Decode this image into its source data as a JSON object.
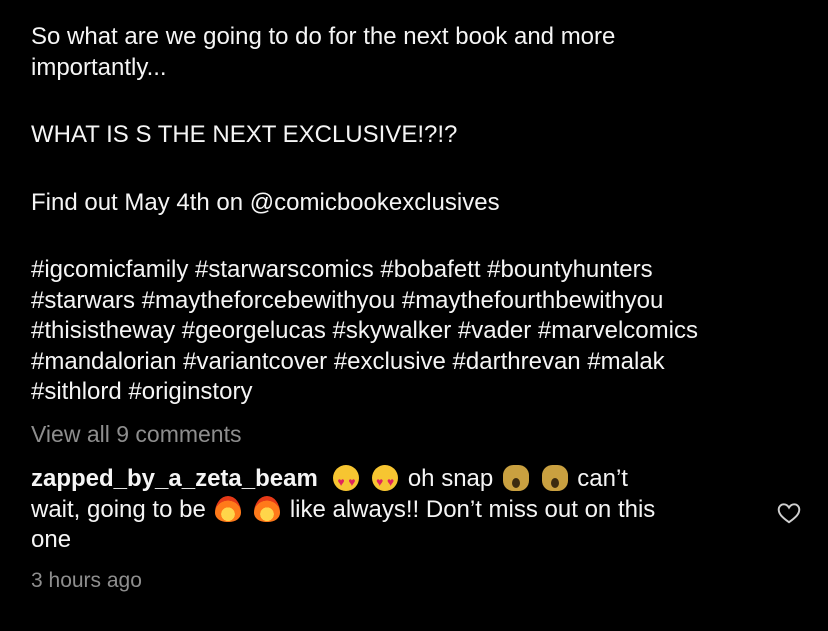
{
  "post": {
    "caption_lines": [
      "So what are we going to do for the next book and more",
      "importantly...",
      "WHAT IS S THE NEXT EXCLUSIVE!?!?",
      "Find out May 4th on @comicbookexclusives",
      "#igcomicfamily #starwarscomics #bobafett #bountyhunters",
      "#starwars #maytheforcebewithyou #maythefourthbewithyou",
      "#thisistheway #georgelucas #skywalker #vader #marvelcomics",
      "#mandalorian #variantcover #exclusive #darthrevan #malak",
      "#sithlord #originstory"
    ]
  },
  "view_all_comments": "View all 9 comments",
  "comment": {
    "username": "zapped_by_a_zeta_beam",
    "text_1": "oh snap",
    "text_2": "can’t",
    "text_3": "wait, going to be",
    "text_4": "like always!! Don’t miss out on this",
    "text_5": "one",
    "icons": {
      "emoji_1": "heart-eyes-cat-emoji",
      "emoji_2": "scream-cat-emoji",
      "emoji_3": "fire-emoji",
      "like": "heart-outline-icon"
    }
  },
  "timestamp": "3 hours ago",
  "colors": {
    "background": "#000000",
    "text": "#f5f5f5",
    "muted": "#8e8e8e"
  }
}
